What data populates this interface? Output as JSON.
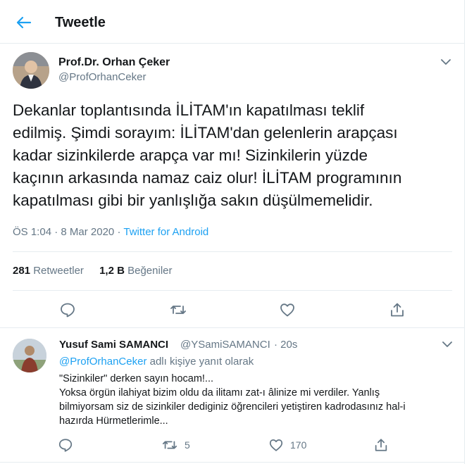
{
  "header": {
    "title": "Tweetle"
  },
  "tweet": {
    "author_name": "Prof.Dr. Orhan Çeker",
    "author_handle": "@ProfOrhanCeker",
    "text": "Dekanlar toplantısında İLİTAM'ın kapatılması teklif\nedilmiş. Şimdi sorayım: İLİTAM'dan gelenlerin arapçası\nkadar sizinkilerde arapça var mı! Sizinkilerin yüzde\nkaçının arkasında namaz caiz olur! İLİTAM programının\nkapatılması gibi bir yanlışlığa sakın düşülmemelidir.",
    "time": "ÖS 1:04",
    "separator": "·",
    "date": "8 Mar 2020",
    "source": "Twitter for Android",
    "retweets_count": "281",
    "retweets_label": "Retweetler",
    "likes_count": "1,2 B",
    "likes_label": "Beğeniler"
  },
  "reply": {
    "author_name": "Yusuf Sami SAMANCI",
    "author_handle": "@YSamiSAMANCI",
    "separator": "·",
    "time": "20s",
    "reply_to_handle": "@ProfOrhanCeker",
    "reply_to_suffix": "adlı kişiye yanıt olarak",
    "text": "\"Sizinkiler\" derken sayın hocam!...\nYoksa örgün ilahiyat bizim oldu da ilitamı zat-ı âlinize mi verdiler. Yanlış\nbilmiyorsam siz de sizinkiler dediginiz öğrencileri yetiştiren kadrodasınız hal-i\nhazırda Hürmetlerimle...",
    "retweets": "5",
    "likes": "170"
  },
  "icons": {
    "back": "arrow-left-icon",
    "caret": "chevron-down-icon",
    "reply": "comment-bubble-icon",
    "retweet": "retweet-icon",
    "like": "heart-icon",
    "share": "share-icon"
  },
  "colors": {
    "accent": "#1da1f2",
    "text": "#14171a",
    "secondary": "#657786",
    "border": "#e6ecf0"
  }
}
